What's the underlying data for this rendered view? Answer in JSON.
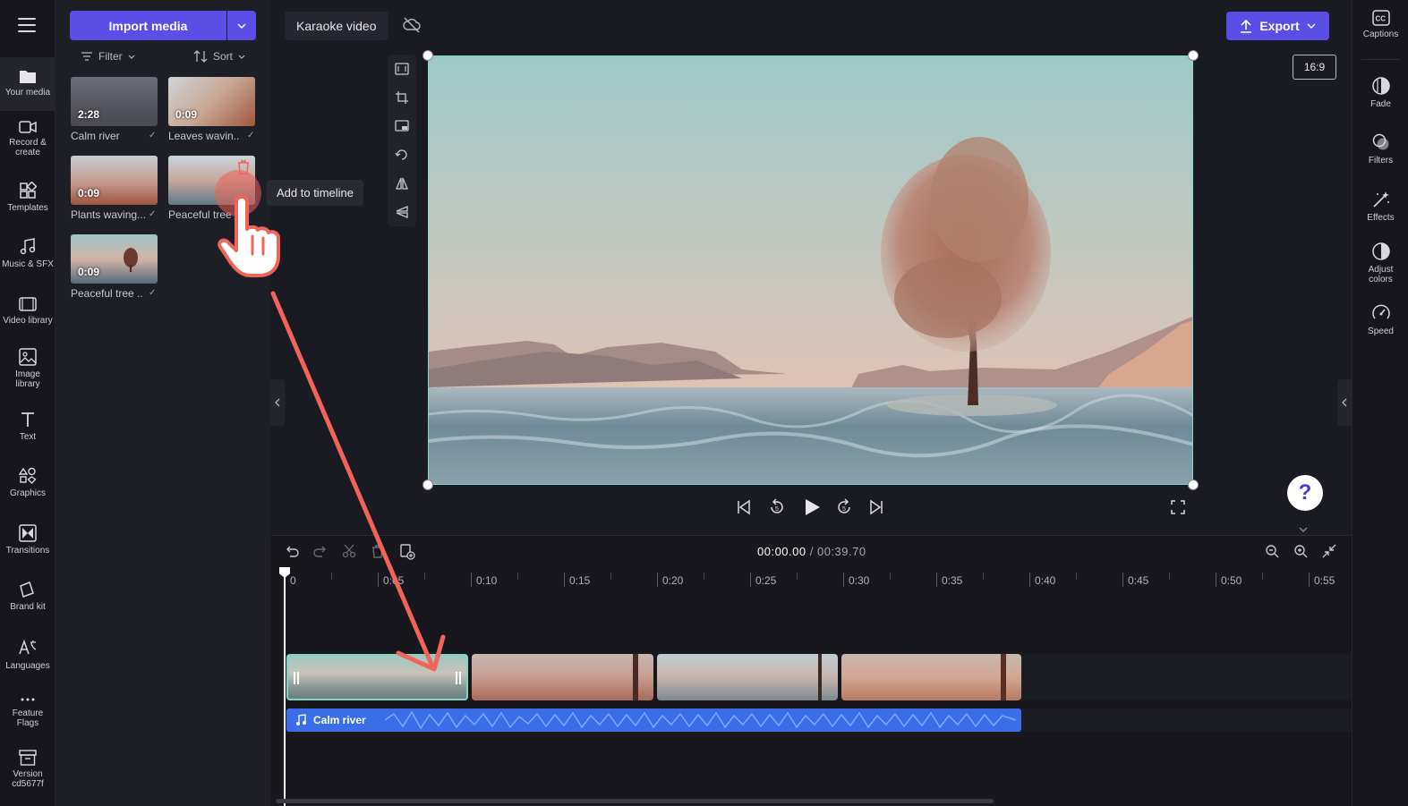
{
  "nav": {
    "items": [
      {
        "label": "Your media",
        "icon": "folder-icon"
      },
      {
        "label": "Record & create",
        "icon": "camera-icon"
      },
      {
        "label": "Templates",
        "icon": "templates-icon"
      },
      {
        "label": "Music & SFX",
        "icon": "music-icon"
      },
      {
        "label": "Video library",
        "icon": "film-icon"
      },
      {
        "label": "Image library",
        "icon": "image-icon"
      },
      {
        "label": "Text",
        "icon": "text-icon"
      },
      {
        "label": "Graphics",
        "icon": "shapes-icon"
      },
      {
        "label": "Transitions",
        "icon": "transitions-icon"
      },
      {
        "label": "Brand kit",
        "icon": "brand-icon"
      },
      {
        "label": "Languages",
        "icon": "languages-icon"
      },
      {
        "label": "Feature Flags",
        "icon": "more-icon"
      },
      {
        "label": "Version cd5677f",
        "icon": "version-icon"
      }
    ]
  },
  "media": {
    "import_label": "Import media",
    "filter_label": "Filter",
    "sort_label": "Sort",
    "items": [
      {
        "duration": "2:28",
        "name": "Calm river"
      },
      {
        "duration": "0:09",
        "name": "Leaves wavin..."
      },
      {
        "duration": "0:09",
        "name": "Plants waving..."
      },
      {
        "duration": "",
        "name": "Peaceful tree ..."
      },
      {
        "duration": "0:09",
        "name": "Peaceful tree ..."
      }
    ],
    "tooltip": "Add to timeline"
  },
  "topbar": {
    "project_name": "Karaoke video",
    "export_label": "Export",
    "aspect_ratio": "16:9"
  },
  "help_label": "?",
  "right_panel": {
    "items": [
      {
        "label": "Captions",
        "icon": "captions-icon"
      },
      {
        "label": "Fade",
        "icon": "fade-icon"
      },
      {
        "label": "Filters",
        "icon": "filters-icon"
      },
      {
        "label": "Effects",
        "icon": "effects-icon"
      },
      {
        "label": "Adjust colors",
        "icon": "adjust-colors-icon"
      },
      {
        "label": "Speed",
        "icon": "speed-icon"
      }
    ]
  },
  "timeline": {
    "current_time": "00:00.00",
    "total_time": "/ 00:39.70",
    "ruler": [
      "0",
      "0:05",
      "0:10",
      "0:15",
      "0:20",
      "0:25",
      "0:30",
      "0:35",
      "0:40",
      "0:45",
      "0:50",
      "0:55"
    ],
    "audio_clip_label": "Calm river"
  },
  "colors": {
    "accent": "#5b4ee6",
    "selection": "#7fd6c4",
    "audio": "#3a6ee8",
    "annotation": "#f0645a"
  }
}
